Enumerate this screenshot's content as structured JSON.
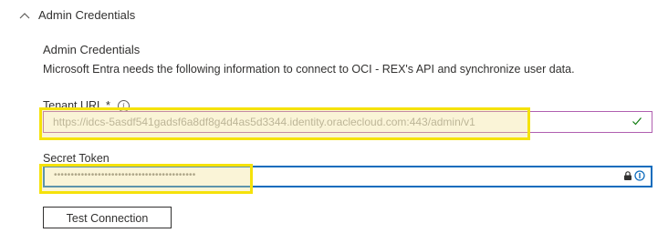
{
  "section": {
    "title": "Admin Credentials",
    "expanded": true
  },
  "admin_credentials": {
    "heading": "Admin Credentials",
    "description": "Microsoft Entra needs the following information to connect to OCI - REX's API and synchronize user data."
  },
  "tenant_url": {
    "label": "Tenant URL",
    "required_marker": "*",
    "value": "https://idcs-5asdf541gadsf6a8df8g4d4as5d3344.identity.oraclecloud.com:443/admin/v1",
    "validated": true
  },
  "secret_token": {
    "label": "Secret Token",
    "masked_value": "••••••••••••••••••••••••••••••••••••••••••"
  },
  "actions": {
    "test_connection_label": "Test Connection"
  },
  "colors": {
    "highlight": "#f5e20a",
    "focus_border": "#0f6cbd",
    "valid_check": "#107c10"
  },
  "icons": {
    "section_toggle": "chevron-up-icon",
    "info": "info-icon",
    "valid": "checkmark-icon",
    "password_manager": "lock-icon",
    "reveal": "reveal-icon"
  }
}
